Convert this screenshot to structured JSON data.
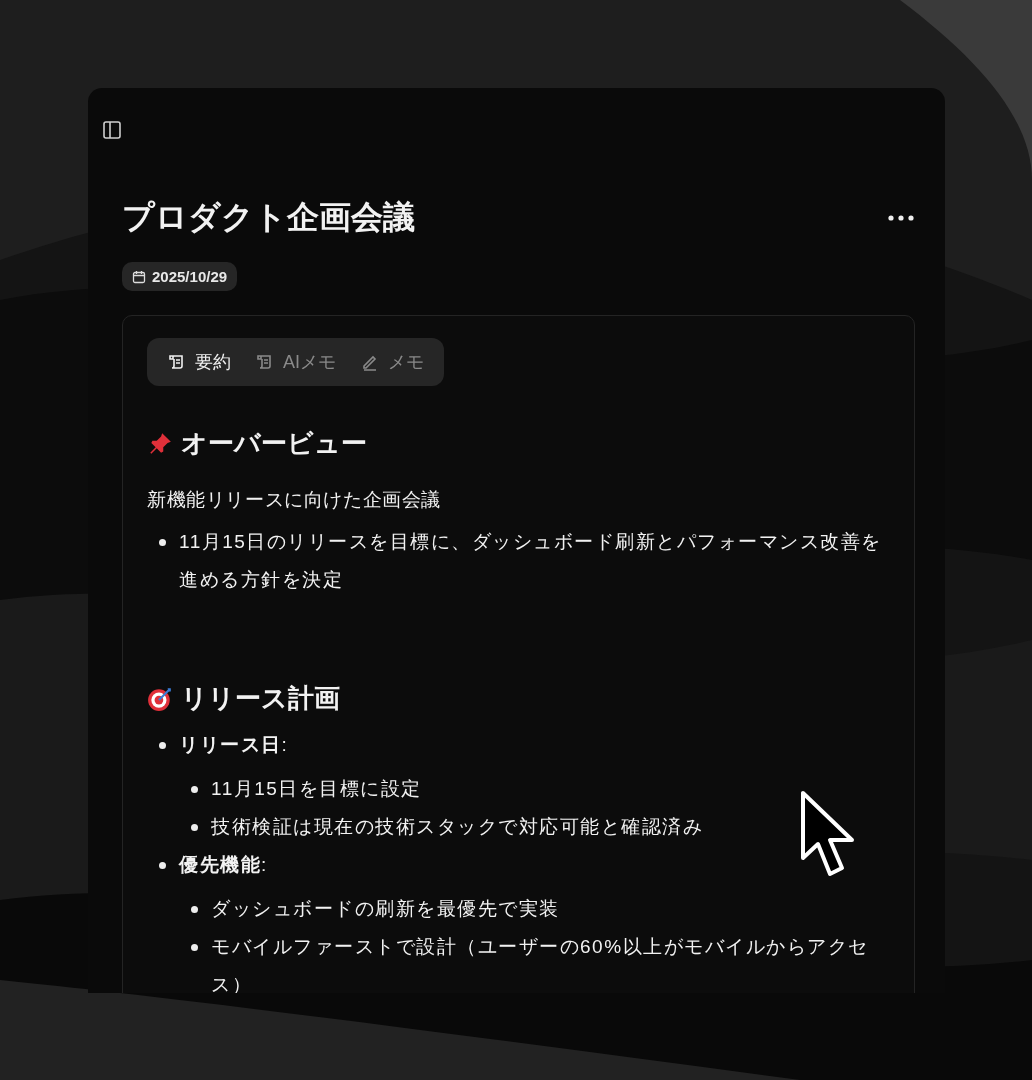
{
  "title": "プロダクト企画会議",
  "date": "2025/10/29",
  "tabs": [
    {
      "label": "要約",
      "kind": "scroll",
      "selected": true
    },
    {
      "label": "AIメモ",
      "kind": "scroll",
      "selected": false
    },
    {
      "label": "メモ",
      "kind": "pencil",
      "selected": false
    }
  ],
  "sections": [
    {
      "kind": "pin",
      "heading": "オーバービュー",
      "paragraph": "新機能リリースに向けた企画会議",
      "items": [
        {
          "text": "11月15日のリリースを目標に、ダッシュボード刷新とパフォーマンス改善を進める方針を決定"
        }
      ]
    },
    {
      "kind": "target",
      "heading": "リリース計画",
      "items": [
        {
          "text": "**リリース日**:",
          "children": [
            {
              "text": "11月15日を目標に設定"
            },
            {
              "text": "技術検証は現在の技術スタックで対応可能と確認済み"
            }
          ]
        },
        {
          "text": "**優先機能**:",
          "children": [
            {
              "text": "ダッシュボードの刷新を最優先で実装"
            },
            {
              "text": "モバイルファーストで設計（ユーザーの60%以上がモバイルからアクセス）"
            }
          ]
        }
      ]
    }
  ]
}
